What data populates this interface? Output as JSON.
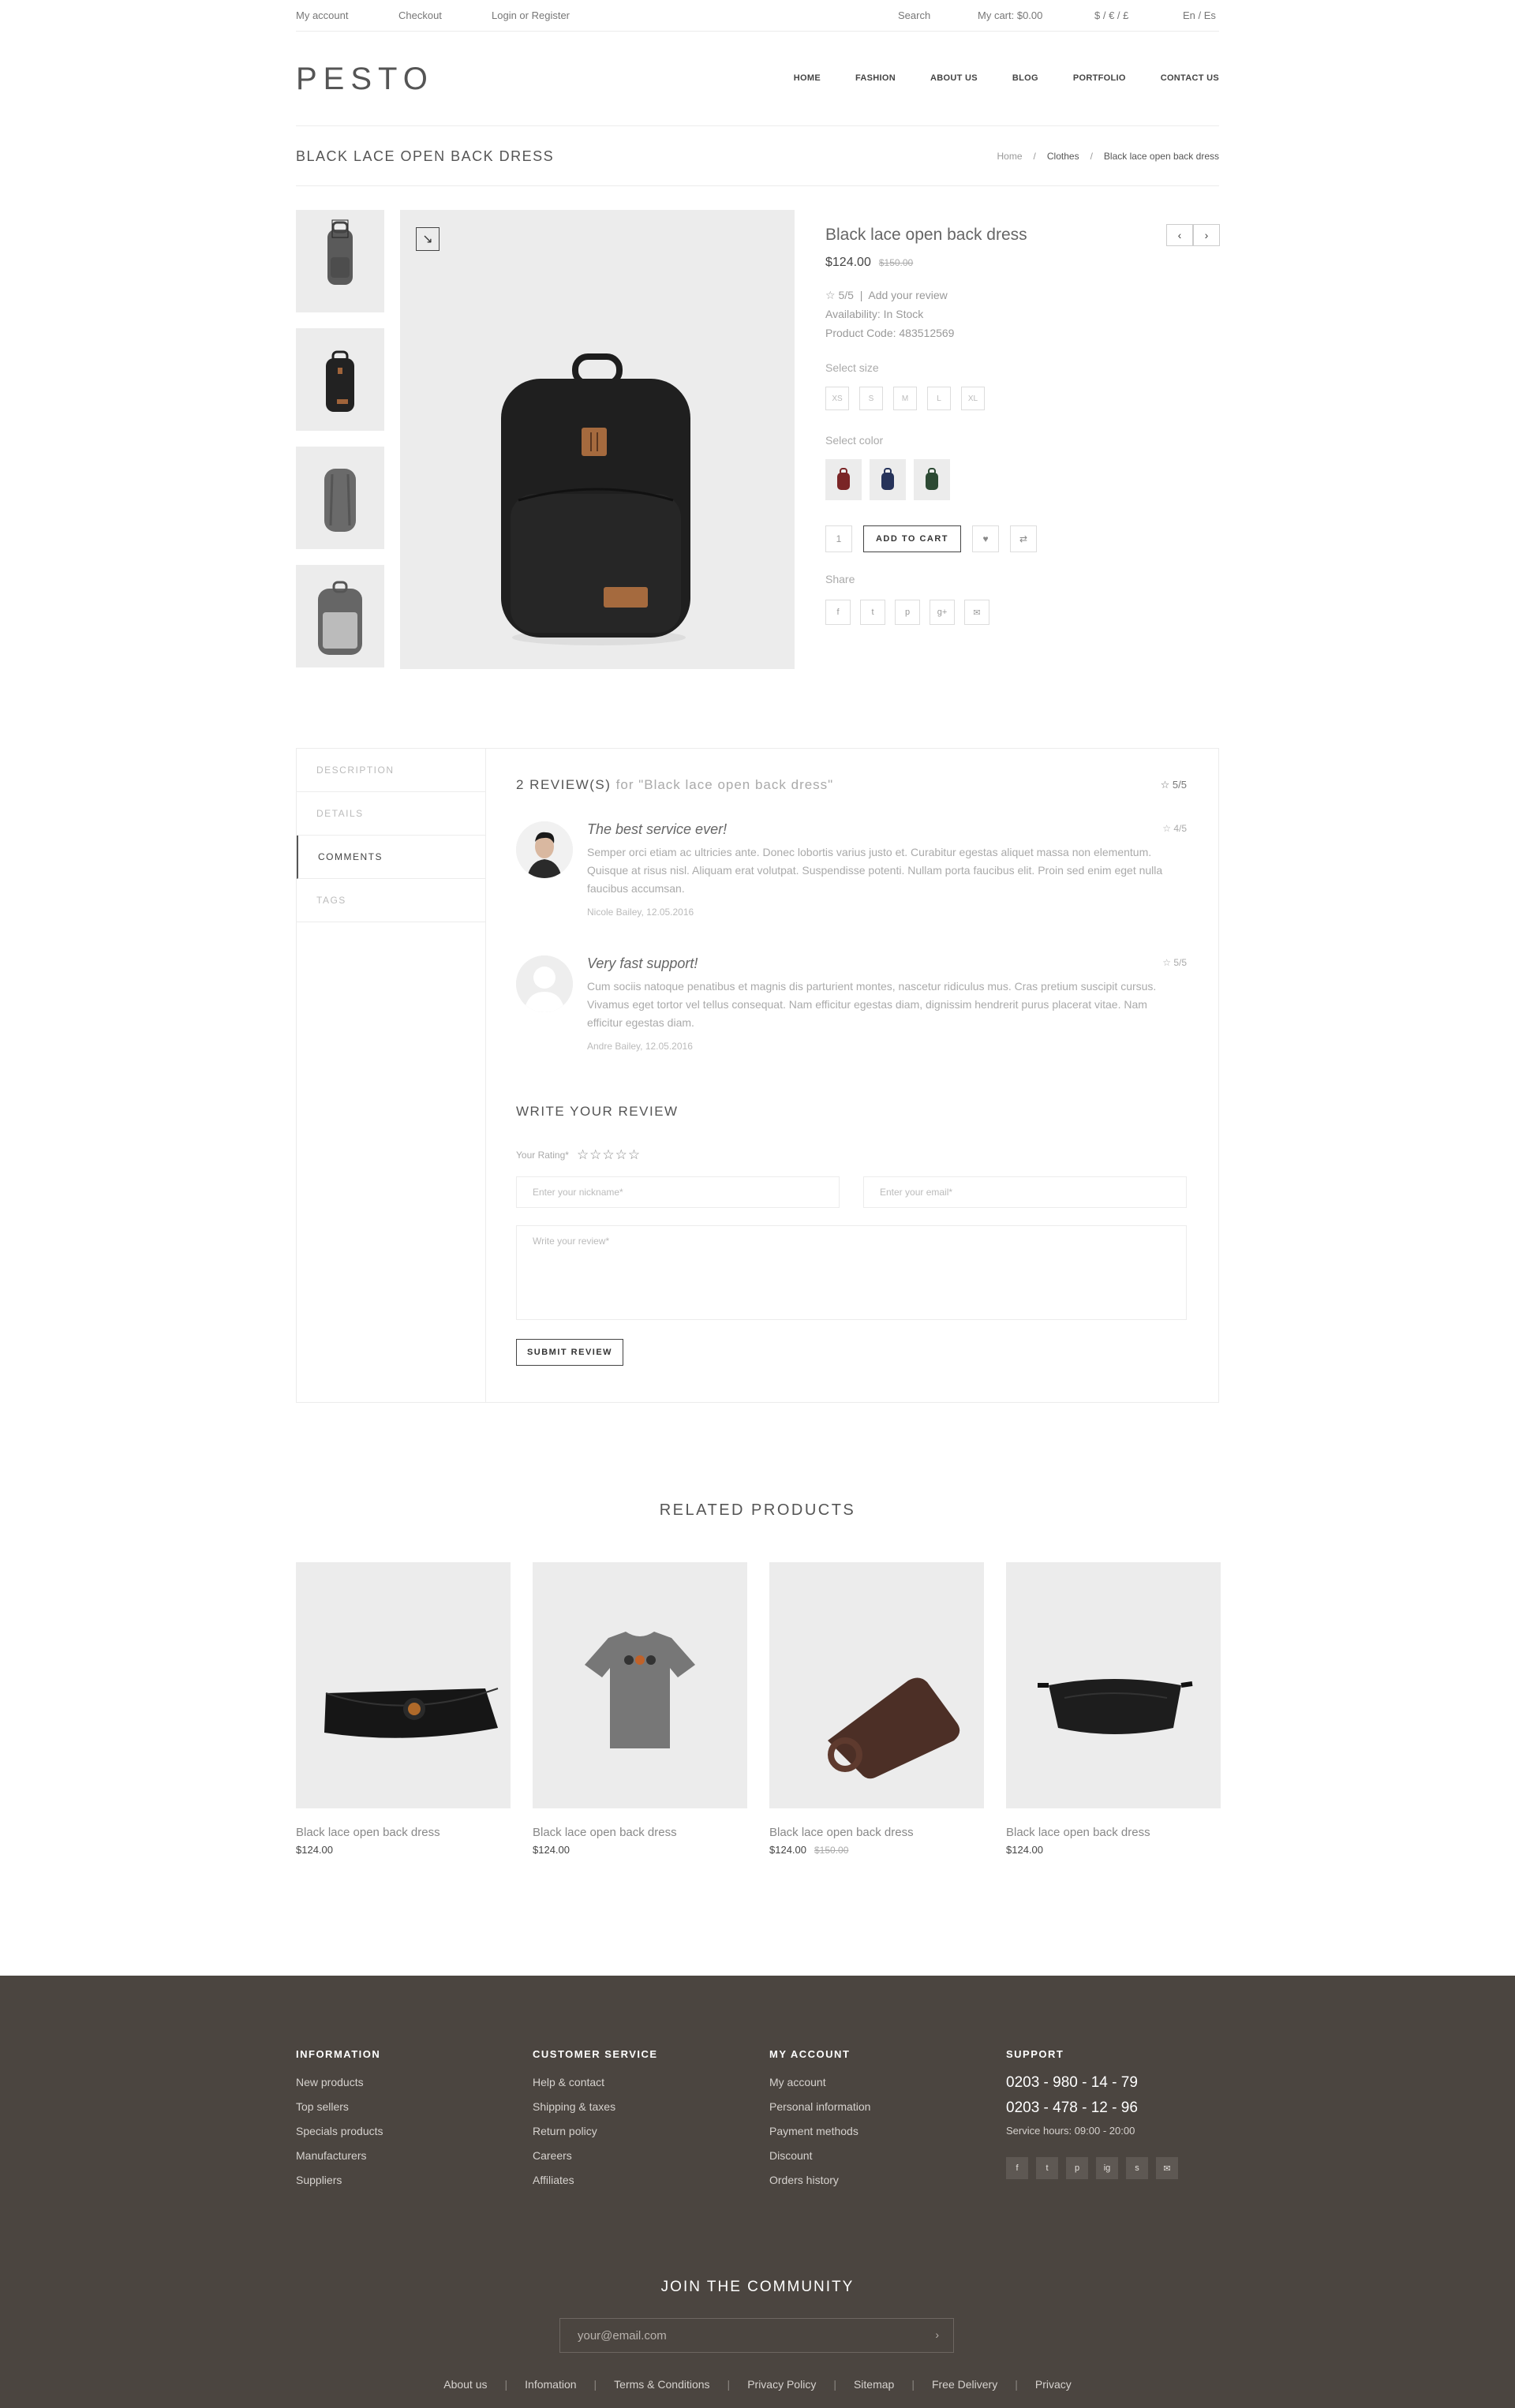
{
  "topbar": {
    "my_account": "My account",
    "checkout": "Checkout",
    "login": "Login or Register",
    "search": "Search",
    "cart": "My cart: $0.00",
    "currency": "$ / € / £",
    "lang": "En / Es"
  },
  "header": {
    "logo": "PESTO",
    "nav": [
      "HOME",
      "FASHION",
      "ABOUT US",
      "BLOG",
      "PORTFOLIO",
      "CONTACT US"
    ]
  },
  "title": {
    "text": "BLACK LACE OPEN BACK DRESS",
    "breadcrumb": [
      "Home",
      "/",
      "Clothes",
      "/",
      "Black lace open back dress"
    ]
  },
  "product": {
    "name": "Black lace open back dress",
    "price": "$124.00",
    "old_price": "$150.00",
    "rating": "5/5",
    "add_review": "Add your review",
    "availability": "Availability: In Stock",
    "code": "Product Code: 483512569",
    "select_size": "Select size",
    "sizes": [
      "XS",
      "S",
      "M",
      "L",
      "XL"
    ],
    "select_color": "Select color",
    "colors": [
      "#7a2526",
      "#26335a",
      "#2d4a34"
    ],
    "qty": "1",
    "add_to_cart": "ADD TO CART",
    "share": "Share",
    "share_icons": [
      "f",
      "t",
      "p",
      "g+",
      "✉"
    ]
  },
  "tabs": [
    "DESCRIPTION",
    "DETAILS",
    "COMMENTS",
    "TAGS"
  ],
  "reviews": {
    "heading": "2 REVIEW(S)",
    "heading_for": "for \"Black lace open back dress\"",
    "overall": "5/5",
    "items": [
      {
        "title": "The best service ever!",
        "stars": "4/5",
        "text": "Semper orci etiam ac ultricies ante. Donec lobortis varius justo et. Curabitur egestas aliquet massa non elementum. Quisque at risus nisl. Aliquam erat volutpat. Suspendisse potenti. Nullam porta faucibus elit. Proin sed enim eget nulla faucibus accumsan.",
        "author": "Nicole Bailey, 12.05.2016"
      },
      {
        "title": "Very fast support!",
        "stars": "5/5",
        "text": "Cum sociis natoque penatibus et magnis dis parturient montes, nascetur ridiculus mus. Cras pretium suscipit cursus. Vivamus eget tortor vel tellus consequat. Nam efficitur egestas diam, dignissim hendrerit purus placerat vitae. Nam efficitur egestas diam.",
        "author": "Andre Bailey, 12.05.2016"
      }
    ],
    "write_heading": "WRITE YOUR REVIEW",
    "your_rating": "Your Rating*",
    "stars_empty": "☆☆☆☆☆",
    "nickname_ph": "Enter your nickname*",
    "email_ph": "Enter your email*",
    "review_ph": "Write your review*",
    "submit": "SUBMIT REVIEW"
  },
  "related": {
    "heading": "RELATED PRODUCTS",
    "items": [
      {
        "name": "Black lace open back dress",
        "price": "$124.00",
        "old": ""
      },
      {
        "name": "Black lace open back dress",
        "price": "$124.00",
        "old": ""
      },
      {
        "name": "Black lace open back dress",
        "price": "$124.00",
        "old": "$150.00"
      },
      {
        "name": "Black lace open back dress",
        "price": "$124.00",
        "old": ""
      }
    ]
  },
  "footer": {
    "cols": [
      {
        "heading": "INFORMATION",
        "links": [
          "New products",
          "Top sellers",
          "Specials products",
          "Manufacturers",
          "Suppliers"
        ]
      },
      {
        "heading": "CUSTOMER SERVICE",
        "links": [
          "Help & contact",
          "Shipping & taxes",
          "Return policy",
          "Careers",
          "Affiliates"
        ]
      },
      {
        "heading": "MY ACCOUNT",
        "links": [
          "My account",
          "Personal information",
          "Payment methods",
          "Discount",
          "Orders history"
        ]
      }
    ],
    "support": {
      "heading": "SUPPORT",
      "phone1": "0203 - 980 - 14 - 79",
      "phone2": "0203 - 478 - 12 - 96",
      "hours": "Service hours: 09:00 - 20:00",
      "social": [
        "f",
        "t",
        "p",
        "ig",
        "s",
        "✉"
      ]
    },
    "join": "JOIN THE COMMUNITY",
    "email_ph": "your@email.com",
    "links": [
      "About us",
      "Infomation",
      "Terms & Conditions",
      "Privacy Policy",
      "Sitemap",
      "Free Delivery",
      "Privacy"
    ]
  }
}
